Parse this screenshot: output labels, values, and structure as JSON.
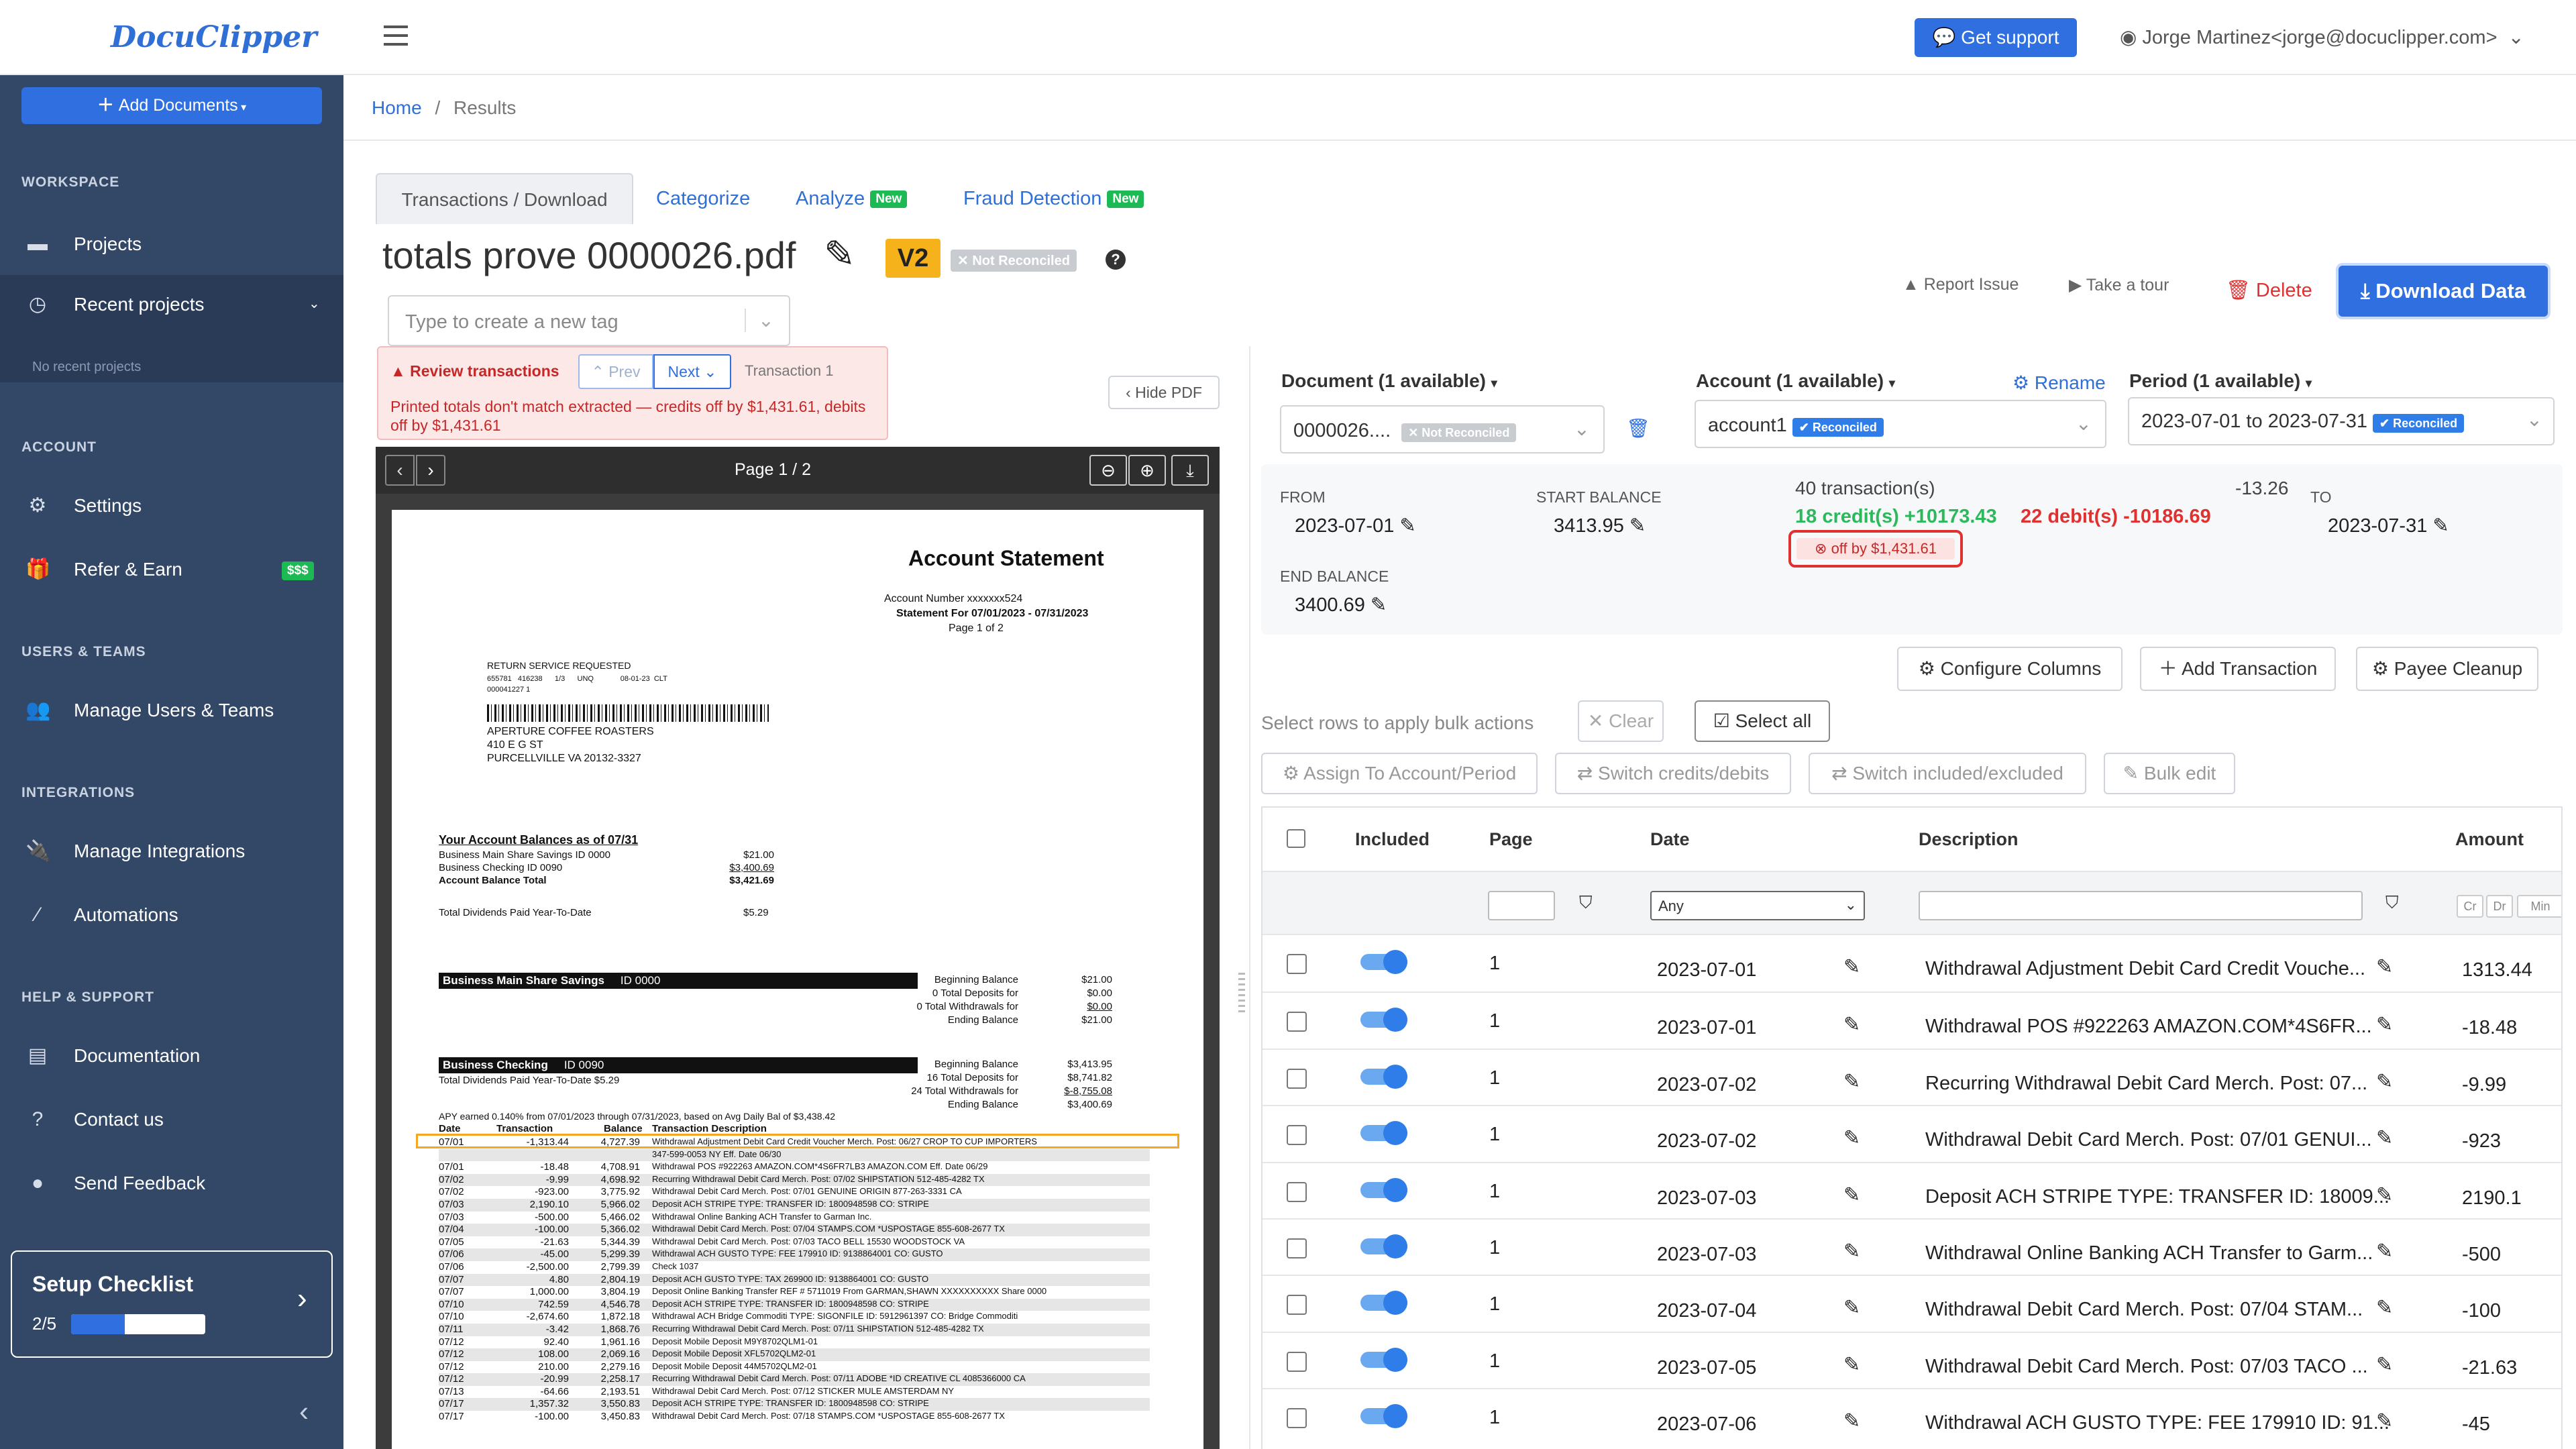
{
  "app": {
    "logo": "DocuClipper"
  },
  "sidebar": {
    "add_documents": "Add Documents",
    "workspace_label": "WORKSPACE",
    "projects": "Projects",
    "recent_projects": "Recent projects",
    "no_recent": "No recent projects",
    "account_label": "ACCOUNT",
    "settings": "Settings",
    "refer": "Refer & Earn",
    "refer_badge": "$$$",
    "users_label": "USERS & TEAMS",
    "manage_users": "Manage Users & Teams",
    "integrations_label": "INTEGRATIONS",
    "manage_integrations": "Manage Integrations",
    "automations": "Automations",
    "help_label": "HELP & SUPPORT",
    "documentation": "Documentation",
    "contact": "Contact us",
    "feedback": "Send Feedback",
    "checklist_title": "Setup Checklist",
    "checklist_progress": "2/5",
    "checklist_fraction": 0.4
  },
  "topbar": {
    "support": "Get support",
    "user": "Jorge Martinez<jorge@docuclipper.com>"
  },
  "breadcrumb": {
    "home": "Home",
    "sep": "/",
    "current": "Results"
  },
  "tabs": [
    {
      "label": "Transactions / Download",
      "new": ""
    },
    {
      "label": "Categorize",
      "new": ""
    },
    {
      "label": "Analyze",
      "new": "New"
    },
    {
      "label": "Fraud Detection",
      "new": "New"
    }
  ],
  "doc": {
    "title": "totals prove 0000026.pdf",
    "version": "V2",
    "status": "Not Reconciled",
    "help": "?",
    "tag_placeholder": "Type to create a new tag",
    "report": "Report Issue",
    "tour": "Take a tour",
    "delete": "Delete",
    "download": "Download Data"
  },
  "review": {
    "label": "Review transactions",
    "prev": "Prev",
    "next": "Next",
    "transaction": "Transaction 1",
    "message": "Printed totals don't match extracted — credits off by $1,431.61, debits off by $1,431.61",
    "hide_pdf": "Hide PDF"
  },
  "viewer": {
    "page": "Page 1 / 2"
  },
  "statement": {
    "title": "Account Statement",
    "acct_line": "Account Number  xxxxxxx524",
    "period_line": "Statement For  07/01/2023 - 07/31/2023",
    "page_line": "Page 1 of 2",
    "return_line": "RETURN SERVICE REQUESTED",
    "small_codes": "655781   416238      1/3      UNQ             08-01-23  CLT",
    "small_code2": "000041227  1",
    "addr1": "APERTURE COFFEE ROASTERS",
    "addr2": "410 E G ST",
    "addr3": "PURCELLVILLE VA 20132-3327",
    "balances_title": "Your Account Balances as of 07/31",
    "bal_rows": [
      {
        "label": "Business Main Share Savings   ID 0000",
        "value": "$21.00"
      },
      {
        "label": "Business Checking   ID 0090",
        "value": "$3,400.69"
      },
      {
        "label": "Account Balance Total",
        "value": "$3,421.69"
      }
    ],
    "dividends": "Total Dividends Paid Year-To-Date",
    "dividends_val": "$5.29",
    "savings_header": "Business Main Share Savings",
    "savings_id": "ID 0000",
    "savings_rows": [
      {
        "label": "Beginning Balance",
        "value": "$21.00"
      },
      {
        "label": "0 Total Deposits for",
        "value": "$0.00"
      },
      {
        "label": "0 Total Withdrawals for",
        "value": "$0.00"
      },
      {
        "label": "Ending Balance",
        "value": "$21.00"
      }
    ],
    "checking_header": "Business Checking",
    "checking_id": "ID 0090",
    "checking_div": "Total Dividends Paid Year-To-Date $5.29",
    "checking_rows": [
      {
        "label": "Beginning Balance",
        "value": "$3,413.95"
      },
      {
        "label": "16 Total Deposits for",
        "value": "$8,741.82"
      },
      {
        "label": "24 Total Withdrawals for",
        "value": "$-8,755.08"
      },
      {
        "label": "Ending Balance",
        "value": "$3,400.69"
      }
    ],
    "apy": "APY earned 0.140% from 07/01/2023 through 07/31/2023, based on Avg Daily Bal of $3,438.42",
    "cols": [
      "Date",
      "Transaction",
      "Balance",
      "Transaction Description"
    ],
    "tx": [
      {
        "d": "07/01",
        "a": "-1,313.44",
        "b": "4,727.39",
        "t": "Withdrawal Adjustment Debit Card Credit Voucher Merch. Post: 06/27 CROP TO CUP IMPORTERS"
      },
      {
        "d": "",
        "a": "",
        "b": "",
        "t": "347-599-0053 NY  Eff. Date 06/30"
      },
      {
        "d": "07/01",
        "a": "-18.48",
        "b": "4,708.91",
        "t": "Withdrawal POS #922263 AMAZON.COM*4S6FR7LB3 AMAZON.COM  Eff. Date 06/29"
      },
      {
        "d": "07/02",
        "a": "-9.99",
        "b": "4,698.92",
        "t": "Recurring Withdrawal Debit Card Merch. Post: 07/02 SHIPSTATION 512-485-4282 TX"
      },
      {
        "d": "07/02",
        "a": "-923.00",
        "b": "3,775.92",
        "t": "Withdrawal Debit Card Merch. Post: 07/01 GENUINE ORIGIN 877-263-3331 CA"
      },
      {
        "d": "07/03",
        "a": "2,190.10",
        "b": "5,966.02",
        "t": "Deposit ACH STRIPE TYPE: TRANSFER ID: 1800948598 CO: STRIPE"
      },
      {
        "d": "07/03",
        "a": "-500.00",
        "b": "5,466.02",
        "t": "Withdrawal Online Banking ACH Transfer to Garman Inc."
      },
      {
        "d": "07/04",
        "a": "-100.00",
        "b": "5,366.02",
        "t": "Withdrawal Debit Card Merch. Post: 07/04 STAMPS.COM *USPOSTAGE 855-608-2677 TX"
      },
      {
        "d": "07/05",
        "a": "-21.63",
        "b": "5,344.39",
        "t": "Withdrawal Debit Card Merch. Post: 07/03 TACO BELL 15530 WOODSTOCK VA"
      },
      {
        "d": "07/06",
        "a": "-45.00",
        "b": "5,299.39",
        "t": "Withdrawal ACH GUSTO TYPE: FEE 179910 ID: 9138864001 CO: GUSTO"
      },
      {
        "d": "07/06",
        "a": "-2,500.00",
        "b": "2,799.39",
        "t": "Check 1037"
      },
      {
        "d": "07/07",
        "a": "4.80",
        "b": "2,804.19",
        "t": "Deposit ACH GUSTO TYPE: TAX 269900 ID: 9138864001 CO: GUSTO"
      },
      {
        "d": "07/07",
        "a": "1,000.00",
        "b": "3,804.19",
        "t": "Deposit Online Banking Transfer REF # 5711019 From GARMAN,SHAWN XXXXXXXXXX Share 0000"
      },
      {
        "d": "07/10",
        "a": "742.59",
        "b": "4,546.78",
        "t": "Deposit ACH STRIPE TYPE: TRANSFER ID: 1800948598 CO: STRIPE"
      },
      {
        "d": "07/10",
        "a": "-2,674.60",
        "b": "1,872.18",
        "t": "Withdrawal ACH Bridge Commoditi TYPE: SIGONFILE ID: 5912961397 CO: Bridge Commoditi"
      },
      {
        "d": "07/11",
        "a": "-3.42",
        "b": "1,868.76",
        "t": "Recurring Withdrawal Debit Card Merch. Post: 07/11 SHIPSTATION 512-485-4282 TX"
      },
      {
        "d": "07/12",
        "a": "92.40",
        "b": "1,961.16",
        "t": "Deposit Mobile Deposit M9Y8702QLM1-01"
      },
      {
        "d": "07/12",
        "a": "108.00",
        "b": "2,069.16",
        "t": "Deposit Mobile Deposit XFL5702QLM2-01"
      },
      {
        "d": "07/12",
        "a": "210.00",
        "b": "2,279.16",
        "t": "Deposit Mobile Deposit 44M5702QLM2-01"
      },
      {
        "d": "07/12",
        "a": "-20.99",
        "b": "2,258.17",
        "t": "Recurring Withdrawal Debit Card Merch. Post: 07/11 ADOBE *ID CREATIVE CL 4085366000 CA"
      },
      {
        "d": "07/13",
        "a": "-64.66",
        "b": "2,193.51",
        "t": "Withdrawal Debit Card Merch. Post: 07/12 STICKER MULE AMSTERDAM NY"
      },
      {
        "d": "07/17",
        "a": "1,357.32",
        "b": "3,550.83",
        "t": "Deposit ACH STRIPE TYPE: TRANSFER ID: 1800948598 CO: STRIPE"
      },
      {
        "d": "07/17",
        "a": "-100.00",
        "b": "3,450.83",
        "t": "Withdrawal Debit Card Merch. Post: 07/18 STAMPS.COM *USPOSTAGE 855-608-2677 TX"
      }
    ]
  },
  "right": {
    "document_label": "Document (1 available)",
    "document_value": "0000026....",
    "document_status": "Not Reconciled",
    "account_label": "Account (1 available)",
    "rename": "Rename",
    "account_value": "account1",
    "account_status": "Reconciled",
    "period_label": "Period (1 available)",
    "period_value": "2023-07-01 to 2023-07-31",
    "period_status": "Reconciled",
    "from_label": "FROM",
    "from_value": "2023-07-01",
    "start_label": "START BALANCE",
    "start_value": "3413.95",
    "tx_count": "40 transaction(s)",
    "credits": "18 credit(s) +10173.43",
    "debits": "22 debit(s) -10186.69",
    "net": "-13.26",
    "off_by": "off by $1,431.61",
    "to_label": "TO",
    "to_value": "2023-07-31",
    "end_label": "END BALANCE",
    "end_value": "3400.69",
    "configure": "Configure Columns",
    "add_tx": "Add Transaction",
    "payee": "Payee Cleanup",
    "bulk_hint": "Select rows to apply bulk actions",
    "clear": "Clear",
    "select_all": "Select all",
    "assign": "Assign To Account/Period",
    "switch_cd": "Switch credits/debits",
    "switch_ie": "Switch included/excluded",
    "bulk_edit": "Bulk edit"
  },
  "table": {
    "headers": {
      "included": "Included",
      "page": "Page",
      "date": "Date",
      "description": "Description",
      "amount": "Amount"
    },
    "filter_date": "Any",
    "amount_filters": [
      "Cr",
      "Dr",
      "Min"
    ],
    "rows": [
      {
        "page": "1",
        "date": "2023-07-01",
        "desc": "Withdrawal Adjustment Debit Card Credit Vouche...",
        "amount": "1313.44"
      },
      {
        "page": "1",
        "date": "2023-07-01",
        "desc": "Withdrawal POS #922263 AMAZON.COM*4S6FR...",
        "amount": "-18.48"
      },
      {
        "page": "1",
        "date": "2023-07-02",
        "desc": "Recurring Withdrawal Debit Card Merch. Post: 07...",
        "amount": "-9.99"
      },
      {
        "page": "1",
        "date": "2023-07-02",
        "desc": "Withdrawal Debit Card Merch. Post: 07/01 GENUI...",
        "amount": "-923"
      },
      {
        "page": "1",
        "date": "2023-07-03",
        "desc": "Deposit ACH STRIPE TYPE: TRANSFER ID: 18009...",
        "amount": "2190.1"
      },
      {
        "page": "1",
        "date": "2023-07-03",
        "desc": "Withdrawal Online Banking ACH Transfer to Garm...",
        "amount": "-500"
      },
      {
        "page": "1",
        "date": "2023-07-04",
        "desc": "Withdrawal Debit Card Merch. Post: 07/04 STAM...",
        "amount": "-100"
      },
      {
        "page": "1",
        "date": "2023-07-05",
        "desc": "Withdrawal Debit Card Merch. Post: 07/03 TACO ...",
        "amount": "-21.63"
      },
      {
        "page": "1",
        "date": "2023-07-06",
        "desc": "Withdrawal ACH GUSTO TYPE: FEE 179910 ID: 91...",
        "amount": "-45"
      }
    ]
  },
  "colors": {
    "sidebar": "#334766",
    "accent": "#2f6fe0",
    "danger": "#e03131",
    "success": "#1db954"
  }
}
